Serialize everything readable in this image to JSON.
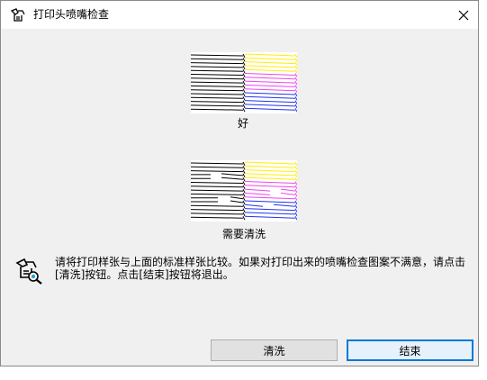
{
  "window": {
    "title": "打印头喷嘴检查",
    "icons": {
      "app": "printer-check-icon",
      "close": "close-icon"
    }
  },
  "patterns": {
    "good": {
      "label": "好",
      "state": "all-lines-intact"
    },
    "needs_cleaning": {
      "label": "需要清洗",
      "state": "gaps-in-lines"
    }
  },
  "instruction": {
    "line1": "请将打印样张与上面的标准样张比较。如果对打印出来的喷嘴检查图案不满意，请点击",
    "line2": "[清洗]按钮。点击[结束]按钮将退出。",
    "icon": "printer-inspect-icon"
  },
  "buttons": {
    "clean_label": "清洗",
    "end_label": "结束"
  },
  "colors": {
    "black": "#000000",
    "yellow": "#ffee00",
    "magenta": "#ee44ee",
    "blue": "#2233ee",
    "focus_border": "#0078d7"
  }
}
